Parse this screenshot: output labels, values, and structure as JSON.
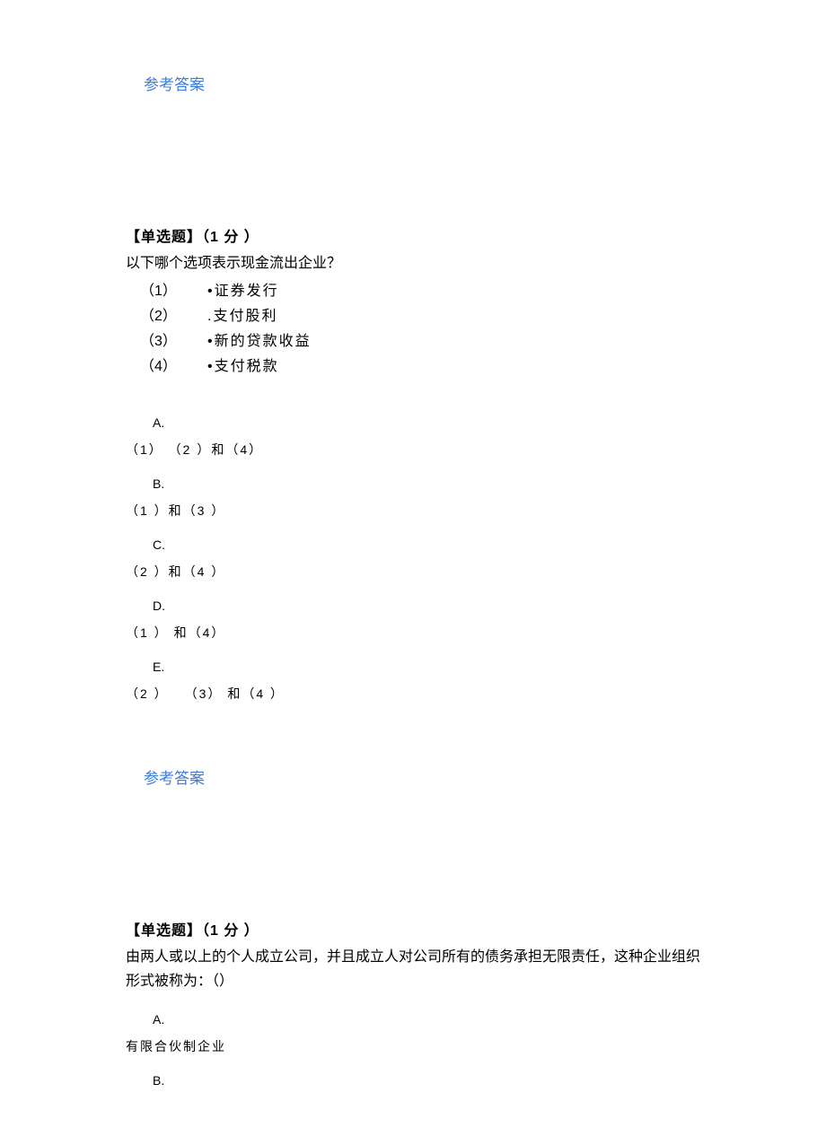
{
  "answer_link_1": "参考答案",
  "q1": {
    "header": "【单选题】（1 分 ）",
    "text": "以下哪个选项表示现金流出企业？",
    "items": [
      {
        "num": "（1）",
        "bullet": "•",
        "text": "证券发行"
      },
      {
        "num": "（2）",
        "bullet": ".",
        "text": "支付股利"
      },
      {
        "num": "（3）",
        "bullet": "•",
        "text": "新的贷款收益"
      },
      {
        "num": "（4）",
        "bullet": "•",
        "text": "支付税款"
      }
    ],
    "options": [
      {
        "label": "A.",
        "value": "（1） （2 ）和（4）"
      },
      {
        "label": "B.",
        "value": "（1 ）和（3 ）"
      },
      {
        "label": "C.",
        "value": "（2 ）和（4 ）"
      },
      {
        "label": "D.",
        "value": "（1 ）  和（4）"
      },
      {
        "label": "E.",
        "value": "（2 ）　　（3）  和（4 ）"
      }
    ]
  },
  "answer_link_2": "参考答案",
  "q2": {
    "header": "【单选题】（1 分 ）",
    "text": "由两人或以上的个人成立公司，并且成立人对公司所有的债务承担无限责任，这种企业组织形式被称为：（）",
    "options": [
      {
        "label": "A.",
        "value": "有限合伙制企业"
      },
      {
        "label": "B.",
        "value": ""
      }
    ]
  }
}
